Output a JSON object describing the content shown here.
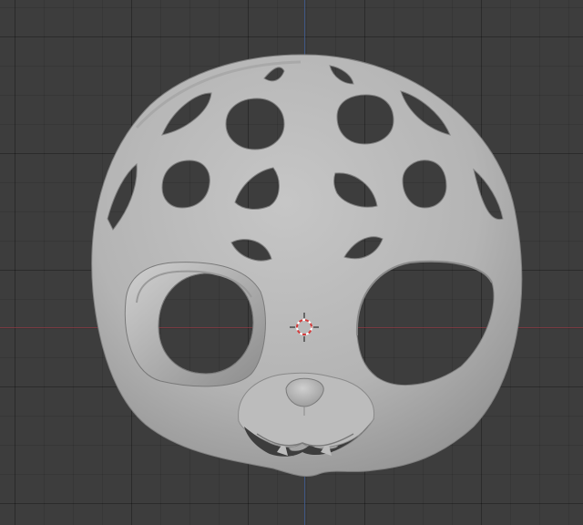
{
  "viewport": {
    "background": "#3d3d3d",
    "grid_color": "#333333",
    "x_axis_color": "#8a3a44",
    "y_axis_color": "#3f5a8a",
    "object": "mask-mesh",
    "cursor_icon": "3d-cursor-icon",
    "mesh_color": "#b9b9b9"
  }
}
